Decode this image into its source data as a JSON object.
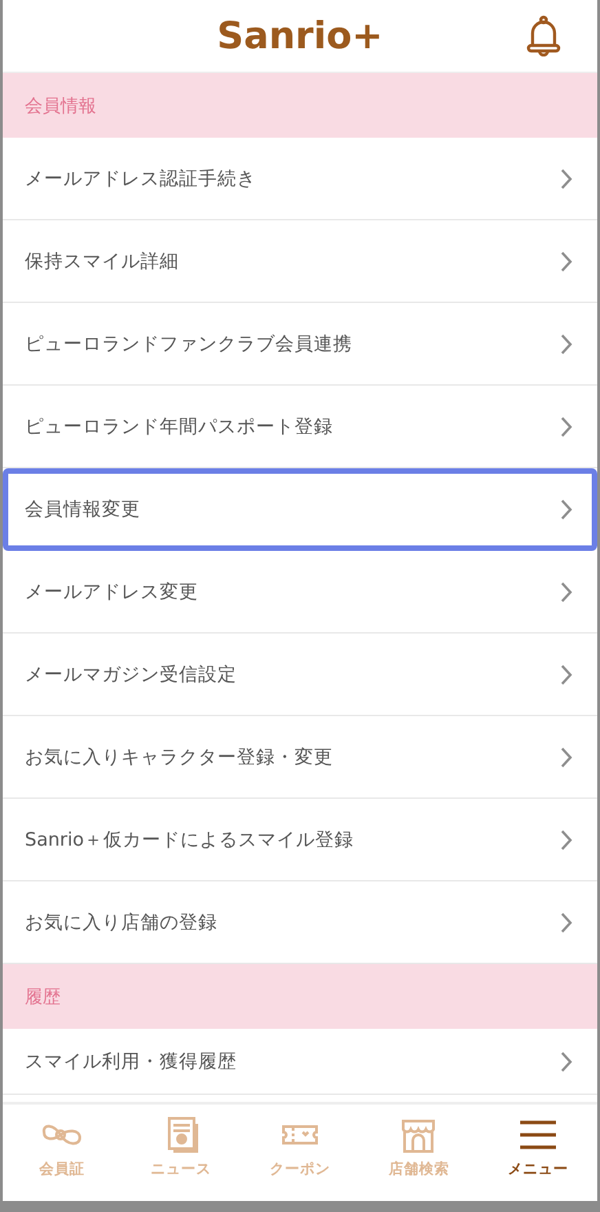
{
  "header": {
    "logo": "Sanrio+"
  },
  "sections": [
    {
      "title": "会員情報",
      "items": [
        {
          "label": "メールアドレス認証手続き",
          "selected": false
        },
        {
          "label": "保持スマイル詳細",
          "selected": false
        },
        {
          "label": "ピューロランドファンクラブ会員連携",
          "selected": false
        },
        {
          "label": "ピューロランド年間パスポート登録",
          "selected": false
        },
        {
          "label": "会員情報変更",
          "selected": true
        },
        {
          "label": "メールアドレス変更",
          "selected": false
        },
        {
          "label": "メールマガジン受信設定",
          "selected": false
        },
        {
          "label": "お気に入りキャラクター登録・変更",
          "selected": false
        },
        {
          "label": "Sanrio＋仮カードによるスマイル登録",
          "selected": false
        },
        {
          "label": "お気に入り店舗の登録",
          "selected": false
        }
      ]
    },
    {
      "title": "履歴",
      "items": [
        {
          "label": "スマイル利用・獲得履歴",
          "selected": false
        }
      ]
    }
  ],
  "tabs": [
    {
      "kind": "bow",
      "label": "会員証",
      "selected": false
    },
    {
      "kind": "news",
      "label": "ニュース",
      "selected": false
    },
    {
      "kind": "coupon",
      "label": "クーポン",
      "selected": false
    },
    {
      "kind": "store",
      "label": "店舗検索",
      "selected": false
    },
    {
      "kind": "menu",
      "label": "メニュー",
      "selected": true
    }
  ]
}
